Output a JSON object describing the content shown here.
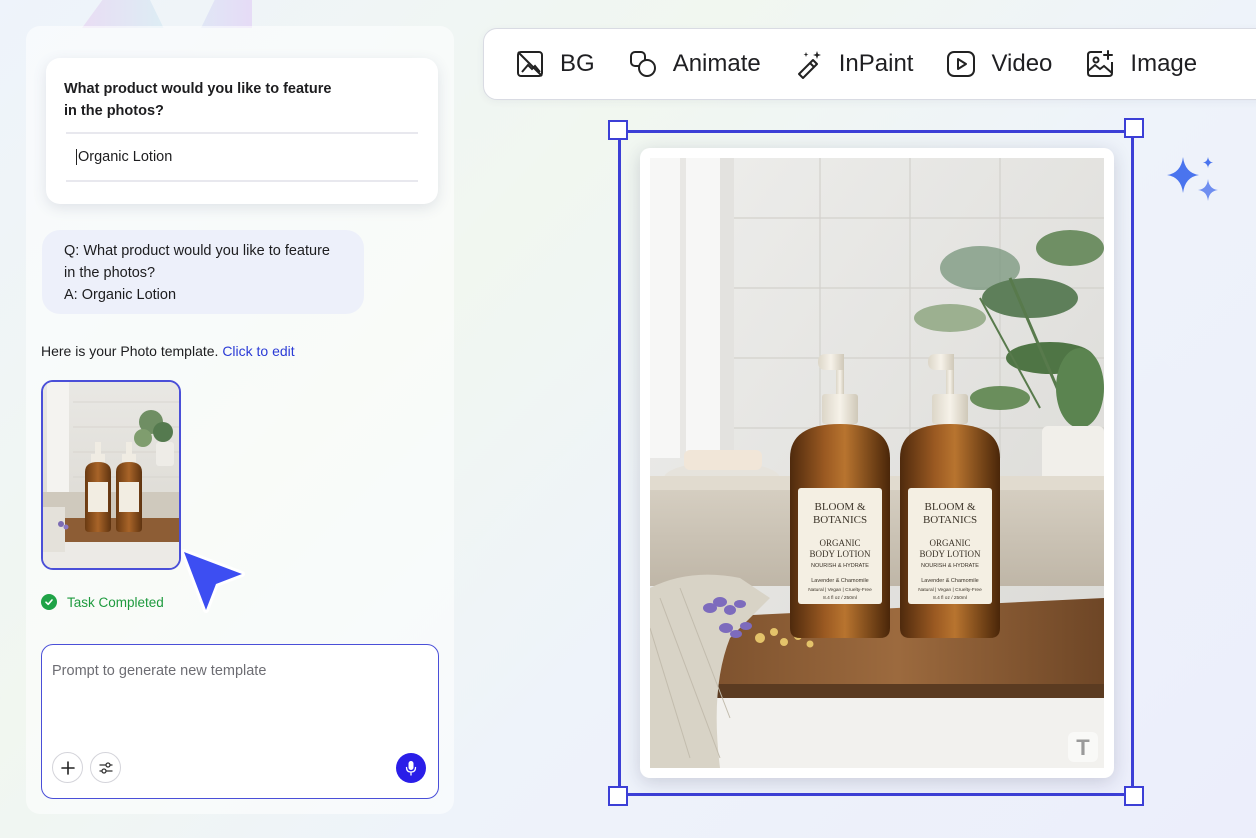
{
  "chat": {
    "question": "What product would you like to feature in the photos?",
    "answer_value": "Organic Lotion",
    "qa_q": "Q: What product would you like to feature in the photos?",
    "qa_a": "A: Organic Lotion",
    "template_text": "Here is your Photo template.",
    "template_link": "Click to edit",
    "status": "Task Completed"
  },
  "prompt": {
    "placeholder": "Prompt to generate new template"
  },
  "toolbar": {
    "items": [
      {
        "label": "BG",
        "icon": "remove-bg-icon"
      },
      {
        "label": "Animate",
        "icon": "animate-icon"
      },
      {
        "label": "InPaint",
        "icon": "magic-wand-icon"
      },
      {
        "label": "Video",
        "icon": "video-play-icon"
      },
      {
        "label": "Image",
        "icon": "image-add-icon"
      }
    ]
  },
  "product": {
    "brand": "BLOOM & BOTANICS",
    "line1": "ORGANIC",
    "line2": "BODY LOTION",
    "line3": "NOURISH & HYDRATE",
    "line4": "Lavender & Chamomile",
    "line5": "Natural | Vegan | Cruelty-Free",
    "line6": "8.4 fl oz / 250ml"
  },
  "watermark": "T",
  "colors": {
    "accent": "#3c3fd6",
    "success": "#1fa347",
    "mic": "#2a1ee8",
    "link": "#2b3bd6"
  }
}
